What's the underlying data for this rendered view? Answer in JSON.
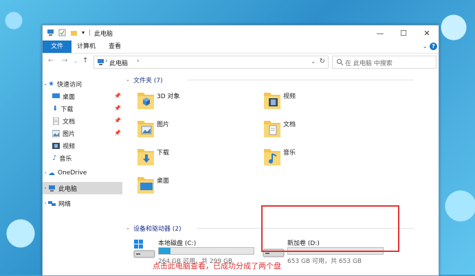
{
  "window": {
    "title": "此电脑"
  },
  "ribbon": {
    "tabs": [
      "文件",
      "计算机",
      "查看"
    ]
  },
  "nav": {
    "path": "此电脑",
    "search_placeholder": "在 此电脑 中搜索"
  },
  "sidebar": {
    "quick_access": "快速访问",
    "items": [
      {
        "label": "桌面",
        "icon": "desktop-icon",
        "pinned": true
      },
      {
        "label": "下载",
        "icon": "download-icon",
        "pinned": true
      },
      {
        "label": "文档",
        "icon": "document-icon",
        "pinned": true
      },
      {
        "label": "图片",
        "icon": "picture-icon",
        "pinned": true
      },
      {
        "label": "视频",
        "icon": "video-icon",
        "pinned": false
      },
      {
        "label": "音乐",
        "icon": "music-icon",
        "pinned": false
      }
    ],
    "onedrive": "OneDrive",
    "this_pc": "此电脑",
    "network": "网络"
  },
  "folders": {
    "header": "文件夹 (7)",
    "items": [
      {
        "name": "3D 对象",
        "icon": "3d-objects-folder-icon"
      },
      {
        "name": "视频",
        "icon": "videos-folder-icon"
      },
      {
        "name": "图片",
        "icon": "pictures-folder-icon"
      },
      {
        "name": "文档",
        "icon": "documents-folder-icon"
      },
      {
        "name": "下载",
        "icon": "downloads-folder-icon"
      },
      {
        "name": "音乐",
        "icon": "music-folder-icon"
      },
      {
        "name": "桌面",
        "icon": "desktop-folder-icon"
      }
    ]
  },
  "drives": {
    "header": "设备和驱动器 (2)",
    "items": [
      {
        "name": "本地磁盘 (C:)",
        "info": "264 GB 可用，共 299 GB",
        "used_fraction": 0.12
      },
      {
        "name": "新加卷 (D:)",
        "info": "653 GB 可用，共 653 GB",
        "used_fraction": 0.0
      }
    ]
  },
  "caption": "点击此电脑查看，已成功分成了两个盘",
  "colors": {
    "accent": "#1979ca",
    "drive_fill": "#26a0da",
    "highlight": "#e03131",
    "group_header": "#1e3287"
  }
}
